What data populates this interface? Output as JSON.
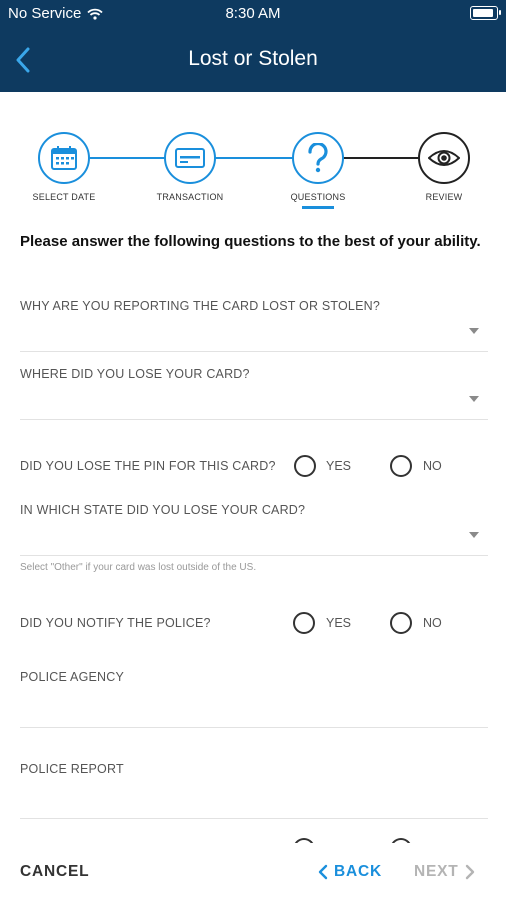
{
  "status_bar": {
    "carrier": "No Service",
    "time": "8:30 AM"
  },
  "header": {
    "title": "Lost or Stolen"
  },
  "stepper": {
    "steps": [
      {
        "label": "SELECT DATE",
        "icon": "calendar-icon",
        "state": "completed"
      },
      {
        "label": "TRANSACTION",
        "icon": "card-icon",
        "state": "completed"
      },
      {
        "label": "QUESTIONS",
        "icon": "question-icon",
        "state": "active"
      },
      {
        "label": "REVIEW",
        "icon": "eye-icon",
        "state": "upcoming"
      }
    ]
  },
  "form": {
    "intro": "Please answer the following questions to the best of your ability.",
    "q_reason": {
      "label": "WHY ARE YOU REPORTING THE CARD LOST OR STOLEN?",
      "value": ""
    },
    "q_where": {
      "label": "WHERE DID YOU LOSE YOUR CARD?",
      "value": ""
    },
    "q_pin": {
      "label": "DID YOU LOSE THE PIN FOR THIS CARD?",
      "yes": "YES",
      "no": "NO"
    },
    "q_state": {
      "label": "IN WHICH STATE DID YOU LOSE YOUR CARD?",
      "value": "",
      "helper": "Select \"Other\" if your card was lost outside of the US."
    },
    "q_police": {
      "label": "DID YOU NOTIFY THE POLICE?",
      "yes": "YES",
      "no": "NO"
    },
    "police_agency": {
      "label": "POLICE AGENCY",
      "value": ""
    },
    "police_report": {
      "label": "POLICE REPORT",
      "value": ""
    }
  },
  "footer": {
    "cancel": "CANCEL",
    "back": "BACK",
    "next": "NEXT"
  },
  "colors": {
    "header_bg": "#0e3a60",
    "accent": "#1a8fdc",
    "disabled": "#b4b4b4"
  }
}
